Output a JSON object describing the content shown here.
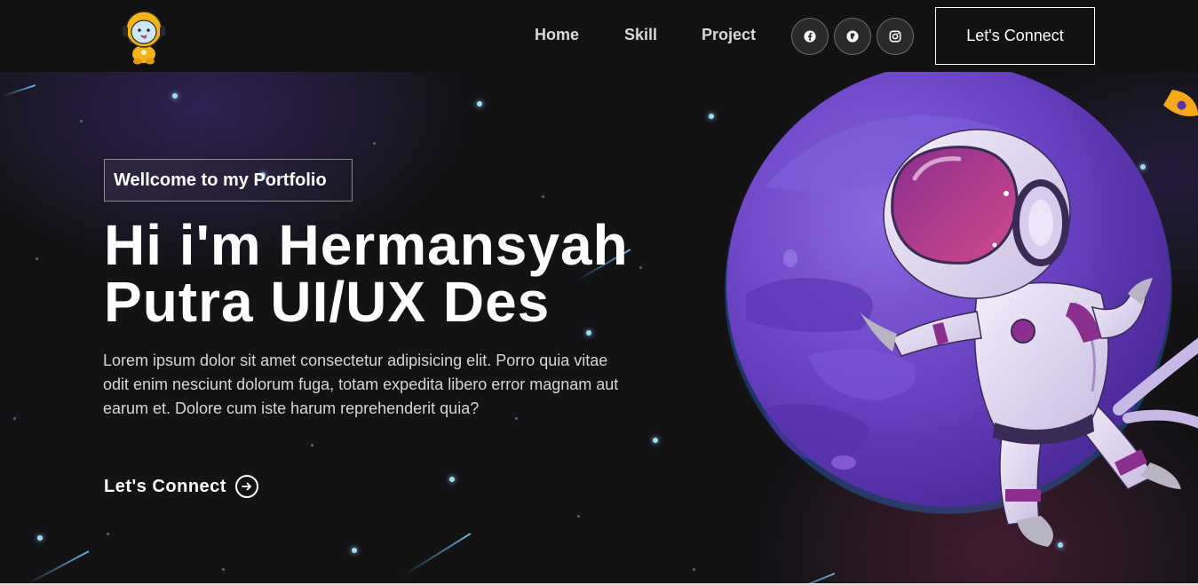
{
  "navbar": {
    "links": [
      {
        "label": "Home"
      },
      {
        "label": "Skill"
      },
      {
        "label": "Project"
      }
    ],
    "socials": [
      {
        "icon": "facebook-icon"
      },
      {
        "icon": "github-icon"
      },
      {
        "icon": "instagram-icon"
      }
    ],
    "connect_label": "Let's Connect"
  },
  "hero": {
    "tagline": "Wellcome to my Portfolio",
    "title_line1": "Hi i'm Hermansyah",
    "title_line2": "Putra UI/UX Des",
    "description": "Lorem ipsum dolor sit amet consectetur adipisicing elit. Porro quia vitae odit enim nesciunt dolorum fuga, totam expedita libero error magnam aut earum et. Dolore cum iste harum reprehenderit quia?",
    "cta_label": "Let's Connect"
  },
  "colors": {
    "background": "#121212",
    "planet": "#6b46c8",
    "star": "#9fdcf5",
    "accent_yellow": "#f5b31a"
  }
}
